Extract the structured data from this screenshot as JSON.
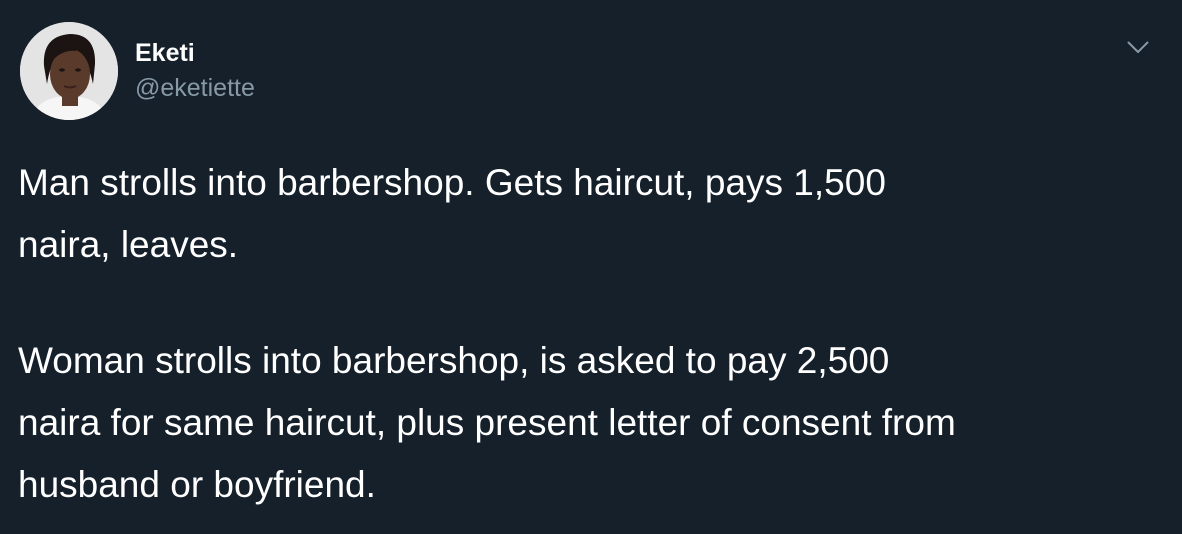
{
  "user": {
    "display_name": "Eketi",
    "handle": "@eketiette",
    "avatar_icon": "profile-photo"
  },
  "header": {
    "menu_icon": "chevron-down-icon"
  },
  "tweet": {
    "paragraphs": [
      "Man strolls into barbershop. Gets haircut, pays 1,500\nnaira, leaves.",
      "Woman strolls into barbershop, is asked to pay 2,500\nnaira for same haircut, plus present letter of consent from\nhusband or boyfriend."
    ]
  },
  "colors": {
    "background": "#15202b",
    "primary_text": "#ffffff",
    "secondary_text": "#8899a6"
  }
}
